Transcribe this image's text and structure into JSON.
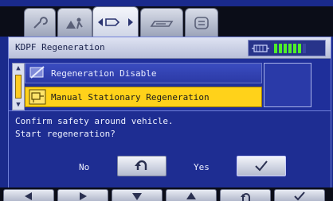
{
  "tabs": [
    {
      "icon": "wrench-icon",
      "active": false
    },
    {
      "icon": "person-icon",
      "active": false
    },
    {
      "icon": "arrow-cycle-icon",
      "active": true
    },
    {
      "icon": "exhaust-icon",
      "active": false
    },
    {
      "icon": "list-icon",
      "active": false
    }
  ],
  "header": {
    "title": "KDPF Regeneration",
    "status_icon": "dpf-icon",
    "level_segments_on": 6,
    "level_segments_total": 7
  },
  "menu": {
    "items": [
      {
        "label": "Regeneration Disable",
        "icon": "disable-icon",
        "selected": false
      },
      {
        "label": "Manual Stationary Regeneration",
        "icon": "manual-regen-icon",
        "selected": true
      }
    ]
  },
  "dialog": {
    "line1": "Confirm safety around vehicle.",
    "line2": "Start regeneration?",
    "no_label": "No",
    "yes_label": "Yes",
    "no_icon": "return-icon",
    "yes_icon": "checkmark-icon"
  },
  "keys": [
    {
      "icon": "left-arrow-icon"
    },
    {
      "icon": "right-arrow-icon"
    },
    {
      "icon": "down-arrow-icon"
    },
    {
      "icon": "up-arrow-icon"
    },
    {
      "icon": "return-icon"
    },
    {
      "icon": "checkmark-icon"
    }
  ],
  "colors": {
    "screen_bg": "#1f2f9a",
    "selected_bg": "#ffd21a",
    "level_on": "#4ef028",
    "header_bg": "#dfe3f2"
  }
}
